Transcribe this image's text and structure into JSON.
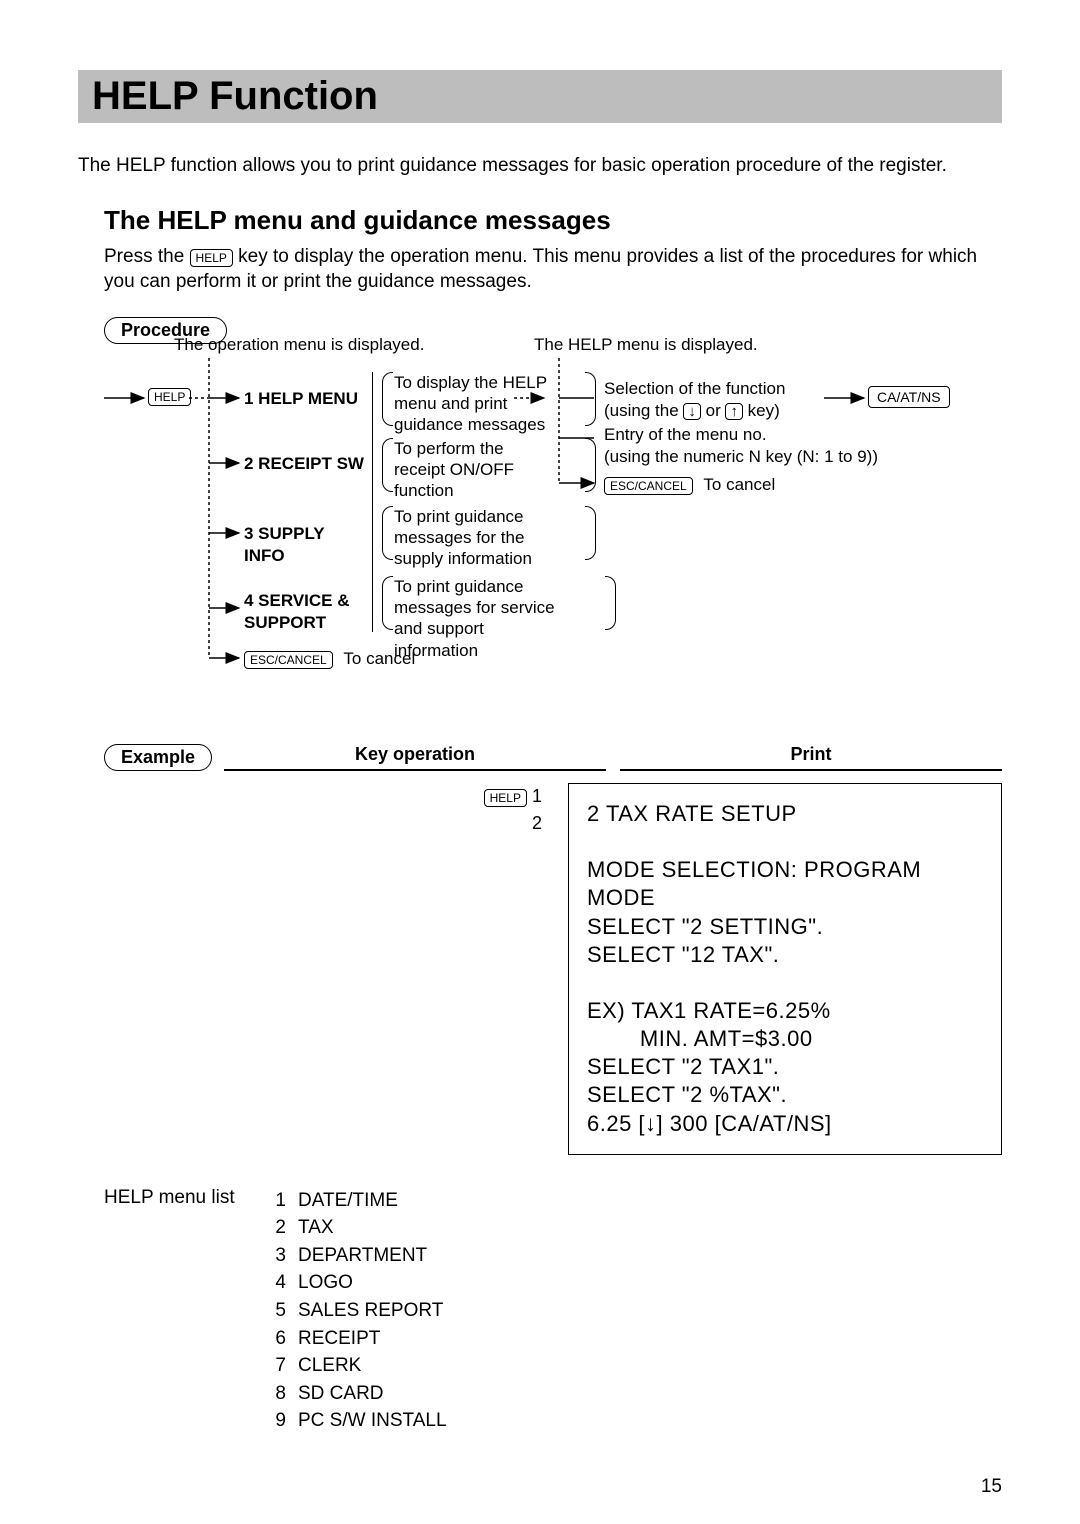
{
  "title": "HELP Function",
  "intro": "The HELP function allows you to print guidance messages for basic operation procedure of the register.",
  "section": {
    "heading": "The HELP menu and guidance messages",
    "body_a": "Press the ",
    "body_b": " key to display the operation menu. This menu provides a list of the procedures for which you can perform it or print the guidance messages."
  },
  "labels": {
    "procedure": "Procedure",
    "example": "Example",
    "key_operation": "Key operation",
    "print": "Print",
    "help_key": "HELP",
    "esc_key": "ESC/CANCEL",
    "ca_key": "CA/AT/NS",
    "down_key": "↓",
    "up_key": "↑",
    "to_cancel": "To cancel",
    "menu_list_label": "HELP menu list"
  },
  "flow": {
    "op_menu_displayed": "The operation menu is displayed.",
    "help_menu_displayed": "The HELP menu is displayed.",
    "items": [
      {
        "label": "1 HELP MENU",
        "desc": "To display the HELP menu and print guidance messages"
      },
      {
        "label": "2 RECEIPT SW",
        "desc": "To perform the receipt ON/OFF function"
      },
      {
        "label": "3 SUPPLY INFO",
        "desc": "To print guidance messages for the supply information"
      },
      {
        "label": "4 SERVICE & SUPPORT",
        "desc": "To print guidance messages for service and support information"
      }
    ],
    "right": {
      "sel_a": "Selection of the function",
      "sel_b_pre": "(using the ",
      "sel_b_mid": " or ",
      "sel_b_post": " key)",
      "entry_a": "Entry of the menu no.",
      "entry_b": "(using the numeric N key (N: 1 to 9))"
    }
  },
  "keyops": {
    "line1_num": "1",
    "line2": "2"
  },
  "receipt": [
    "2 TAX RATE SETUP",
    "",
    "MODE SELECTION: PROGRAM MODE",
    "SELECT \"2 SETTING\".",
    "SELECT \"12 TAX\".",
    "",
    "EX) TAX1 RATE=6.25%",
    "        MIN. AMT=$3.00",
    "SELECT \"2 TAX1\".",
    "SELECT \"2 %TAX\".",
    "6.25 [↓] 300 [CA/AT/NS]"
  ],
  "menu_items": [
    {
      "n": "1",
      "t": "DATE/TIME"
    },
    {
      "n": "2",
      "t": "TAX"
    },
    {
      "n": "3",
      "t": "DEPARTMENT"
    },
    {
      "n": "4",
      "t": "LOGO"
    },
    {
      "n": "5",
      "t": "SALES REPORT"
    },
    {
      "n": "6",
      "t": "RECEIPT"
    },
    {
      "n": "7",
      "t": "CLERK"
    },
    {
      "n": "8",
      "t": "SD CARD"
    },
    {
      "n": "9",
      "t": "PC S/W INSTALL"
    }
  ],
  "page_number": "15"
}
